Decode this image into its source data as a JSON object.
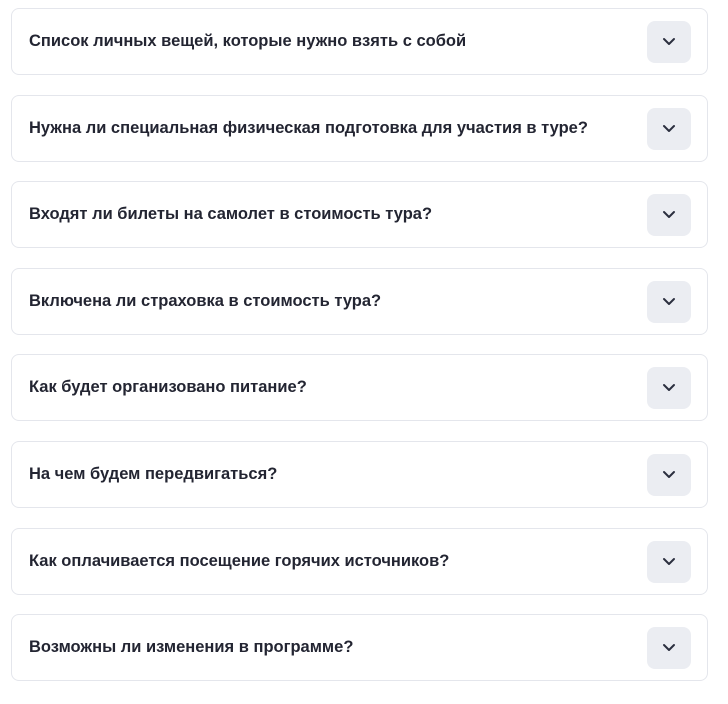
{
  "faq": {
    "items": [
      {
        "question": "Список личных вещей, которые нужно взять с собой",
        "expanded": false,
        "toggle_icon": "chevron-down-icon"
      },
      {
        "question": "Нужна ли специальная физическая подготовка для участия в туре?",
        "expanded": false,
        "toggle_icon": "chevron-down-icon"
      },
      {
        "question": "Входят ли билеты на самолет в стоимость тура?",
        "expanded": false,
        "toggle_icon": "chevron-down-icon"
      },
      {
        "question": "Включена ли страховка в стоимость тура?",
        "expanded": false,
        "toggle_icon": "chevron-down-icon"
      },
      {
        "question": "Как будет организовано питание?",
        "expanded": false,
        "toggle_icon": "chevron-down-icon"
      },
      {
        "question": "На чем будем передвигаться?",
        "expanded": false,
        "toggle_icon": "chevron-down-icon"
      },
      {
        "question": "Как оплачивается посещение горячих источников?",
        "expanded": false,
        "toggle_icon": "chevron-down-icon"
      },
      {
        "question": "Возможны ли изменения в программе?",
        "expanded": false,
        "toggle_icon": "chevron-down-icon"
      }
    ]
  },
  "colors": {
    "card_border": "#e4e6ec",
    "question_text": "#232532",
    "toggle_background": "#ebedf2",
    "chevron": "#2b2f3f"
  }
}
